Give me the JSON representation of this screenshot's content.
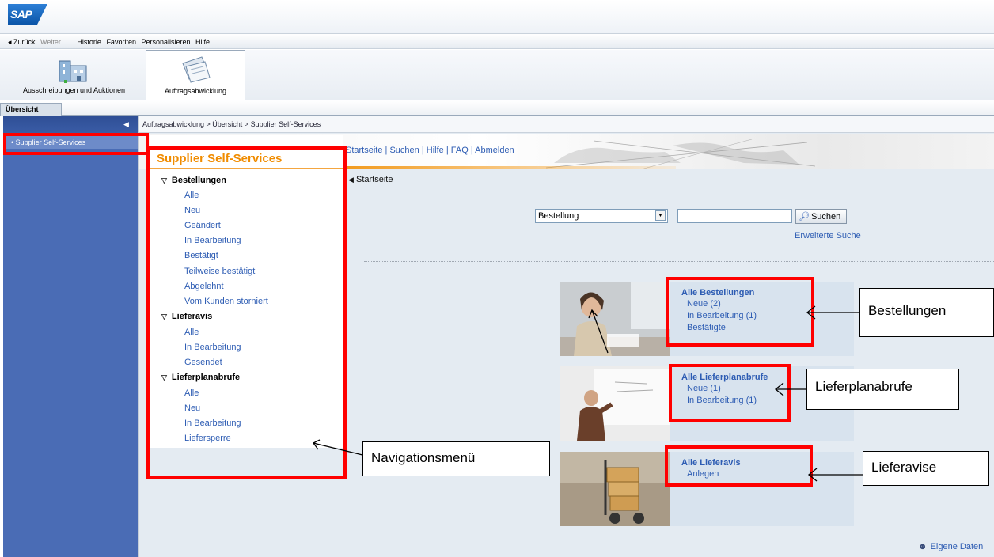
{
  "app": {
    "logo_text": "SAP"
  },
  "navbar": {
    "back": "◂ Zurück",
    "forward": "Weiter",
    "items": [
      "Historie",
      "Favoriten",
      "Personalisieren",
      "Hilfe"
    ]
  },
  "tabs": [
    {
      "label": "Ausschreibungen und Auktionen",
      "icon": "building-icon"
    },
    {
      "label": "Auftragsabwicklung",
      "icon": "documents-icon",
      "selected": true
    }
  ],
  "subtab": {
    "label": "Übersicht"
  },
  "leftnav": {
    "items": [
      "• Supplier Self-Services"
    ]
  },
  "breadcrumb": "Auftragsabwicklung  >  Übersicht  >  Supplier Self-Services",
  "topnav": {
    "items": [
      "Startseite",
      "Suchen",
      "Hilfe",
      "FAQ",
      "Abmelden"
    ],
    "separator": "|"
  },
  "menu": {
    "title": "Supplier Self-Services",
    "groups": [
      {
        "label": "Bestellungen",
        "items": [
          "Alle",
          "Neu",
          "Geändert",
          "In Bearbeitung",
          "Bestätigt",
          "Teilweise bestätigt",
          "Abgelehnt",
          "Vom Kunden storniert"
        ]
      },
      {
        "label": "Lieferavis",
        "items": [
          "Alle",
          "In Bearbeitung",
          "Gesendet"
        ]
      },
      {
        "label": "Lieferplanabrufe",
        "items": [
          "Alle",
          "Neu",
          "In Bearbeitung",
          "Liefersperre"
        ]
      }
    ]
  },
  "main": {
    "startseite": "Startseite"
  },
  "search": {
    "select_value": "Bestellung",
    "input_value": "",
    "button_label": "Suchen",
    "advanced_link": "Erweiterte Suche"
  },
  "cards": [
    {
      "title": "Alle Bestellungen",
      "links": [
        "Neue (2)",
        "In Bearbeitung (1)",
        "Bestätigte"
      ]
    },
    {
      "title": "Alle Lieferplanabrufe",
      "links": [
        "Neue (1)",
        "In Bearbeitung (1)"
      ]
    },
    {
      "title": "Alle Lieferavis",
      "links": [
        "Anlegen"
      ]
    }
  ],
  "annotations": {
    "callouts": [
      "Bestellungen",
      "Lieferplanabrufe",
      "Navigationsmenü",
      "Lieferavise"
    ],
    "color": "#ff0000"
  },
  "footer": {
    "own_data": "Eigene Daten"
  }
}
